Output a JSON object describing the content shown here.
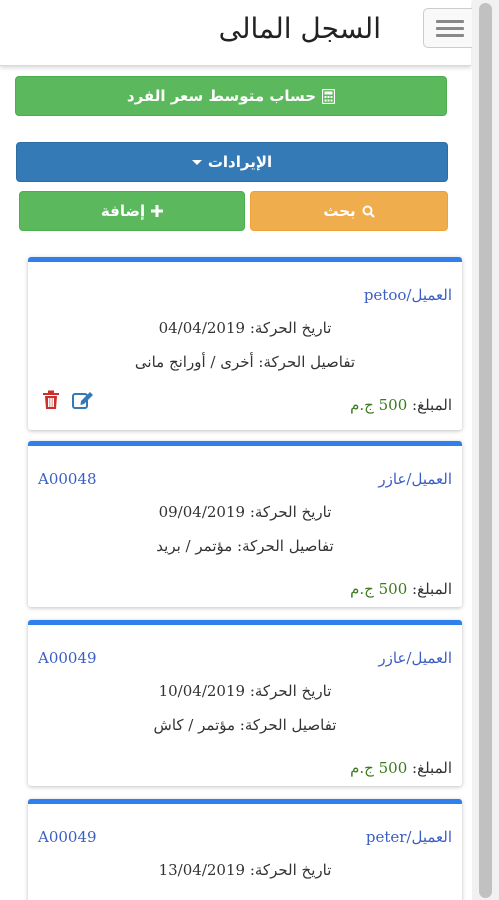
{
  "header": {
    "title": "السجل المالى",
    "menu_icon": "hamburger-icon"
  },
  "buttons": {
    "calc_label": "حساب متوسط سعر الفرد",
    "income_label": "الإيرادات",
    "add_label": "إضافة",
    "search_label": "بحث"
  },
  "cards": [
    {
      "client": "العميل/petoo",
      "code": "",
      "date": "تاريخ الحركة: 04/04/2019",
      "details": "تفاصيل الحركة: أخرى / أورانج مانى",
      "amount_label": "المبلغ:",
      "amount_value": "500 ج.م",
      "show_actions": true
    },
    {
      "client": "العميل/عازر",
      "code": "A00048",
      "date": "تاريخ الحركة: 09/04/2019",
      "details": "تفاصيل الحركة: مؤتمر / بريد",
      "amount_label": "المبلغ:",
      "amount_value": "500 ج.م",
      "show_actions": false
    },
    {
      "client": "العميل/عازر",
      "code": "A00049",
      "date": "تاريخ الحركة: 10/04/2019",
      "details": "تفاصيل الحركة: مؤتمر / كاش",
      "amount_label": "المبلغ:",
      "amount_value": "500 ج.م",
      "show_actions": false
    },
    {
      "client": "العميل/peter",
      "code": "A00049",
      "date": "تاريخ الحركة: 13/04/2019",
      "details": "",
      "amount_label": "",
      "amount_value": "",
      "show_actions": false
    }
  ],
  "colors": {
    "success": "#5cb85c",
    "primary": "#337ab7",
    "warning": "#f0ad4e",
    "card_accent": "#2f80ed",
    "link": "#3a5ec4",
    "amount": "#3c7a1e",
    "danger": "#c9302c"
  }
}
